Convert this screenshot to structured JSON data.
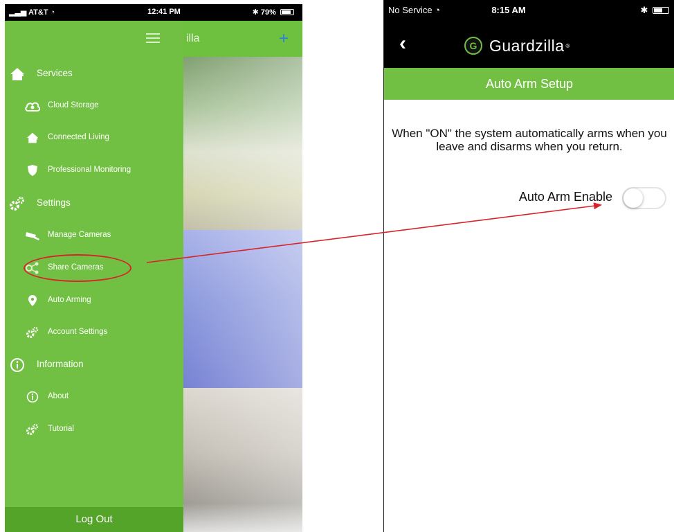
{
  "left_phone": {
    "status": {
      "carrier": "AT&T",
      "time": "12:41 PM",
      "battery": "79%"
    },
    "behind": {
      "logo_fragment": "illa",
      "add_symbol": "+"
    },
    "menu": {
      "services": "Services",
      "cloud_storage": "Cloud Storage",
      "connected_living": "Connected Living",
      "professional_monitoring": "Professional Monitoring",
      "settings": "Settings",
      "manage_cameras": "Manage Cameras",
      "share_cameras": "Share Cameras",
      "auto_arming": "Auto Arming",
      "account_settings": "Account Settings",
      "information": "Information",
      "about": "About",
      "tutorial": "Tutorial"
    },
    "logout_label": "Log Out"
  },
  "right_phone": {
    "status": {
      "carrier": "No Service",
      "time": "8:15 AM"
    },
    "back_symbol": "‹",
    "brand": {
      "logo_letter": "G",
      "name": "Guardzilla"
    },
    "title": "Auto Arm Setup",
    "description": "When \"ON\" the system automatically arms when you leave and disarms when you return.",
    "toggle": {
      "label": "Auto Arm Enable",
      "state": "off"
    }
  },
  "colors": {
    "brand_green": "#72c043",
    "logout_green": "#55a42a",
    "annotation_red": "#d6242a"
  },
  "icons": [
    "house-icon",
    "cloud-icon",
    "shield-icon",
    "gears-icon",
    "camera-icon",
    "share-icon",
    "location-pin-icon",
    "info-icon",
    "bluetooth-icon",
    "wifi-icon",
    "battery-icon",
    "hamburger-icon"
  ]
}
